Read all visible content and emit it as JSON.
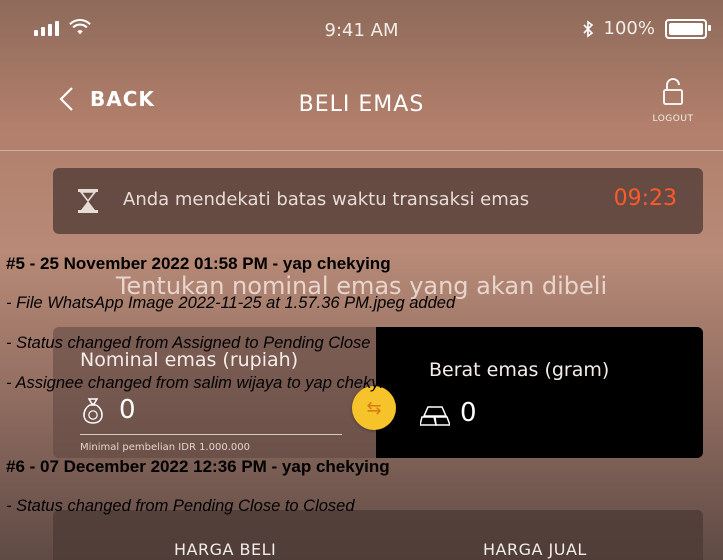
{
  "status_bar": {
    "time": "9:41 AM",
    "battery": "100%"
  },
  "nav": {
    "back_label": "BACK",
    "title": "BELI EMAS",
    "logout_label": "LOGOUT"
  },
  "timer": {
    "message": "Anda mendekati batas waktu transaksi emas",
    "countdown": "09:23"
  },
  "section_heading": "Tentukan nominal emas yang akan dibeli",
  "input_left": {
    "label": "Nominal emas (rupiah)",
    "value": "0",
    "note": "Minimal pembelian IDR 1.000.000"
  },
  "input_right": {
    "label": "Berat emas (gram)",
    "value": "0"
  },
  "prices": {
    "buy_label": "HARGA BELI",
    "sell_label": "HARGA JUAL"
  },
  "log": {
    "entry1": {
      "header": "#5 - 25 November 2022 01:58 PM - yap chekying",
      "items": [
        "- File WhatsApp Image 2022-11-25 at 1.57.36 PM.jpeg added",
        "- Status changed from Assigned to Pending Close",
        "- Assignee changed from salim wijaya to yap chekying"
      ]
    },
    "entry2": {
      "header": "#6 - 07 December 2022 12:36 PM - yap chekying",
      "items": [
        "- Status changed from Pending Close to Closed"
      ]
    }
  }
}
